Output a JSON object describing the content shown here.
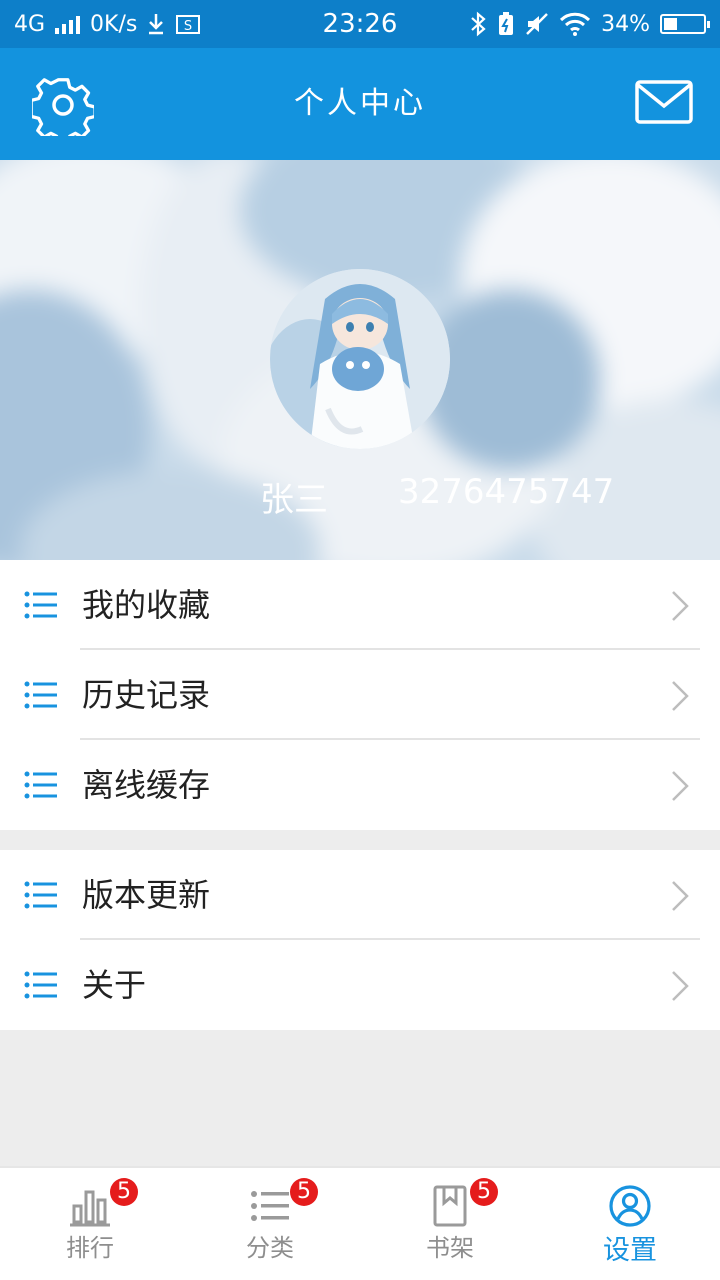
{
  "status_bar": {
    "network": "4G",
    "speed": "0K/s",
    "time": "23:26",
    "battery": "34%"
  },
  "header": {
    "title": "个人中心",
    "left_icon": "gear-icon",
    "right_icon": "mail-icon"
  },
  "profile": {
    "name": "张三",
    "id": "3276475747"
  },
  "menu": {
    "group1": [
      {
        "label": "我的收藏"
      },
      {
        "label": "历史记录"
      },
      {
        "label": "离线缓存"
      }
    ],
    "group2": [
      {
        "label": "版本更新"
      },
      {
        "label": "关于"
      }
    ]
  },
  "bottom_nav": {
    "tabs": [
      {
        "label": "排行",
        "badge": "5",
        "icon": "bar-chart-icon"
      },
      {
        "label": "分类",
        "badge": "5",
        "icon": "list-icon"
      },
      {
        "label": "书架",
        "badge": "5",
        "icon": "bookmark-icon"
      },
      {
        "label": "设置",
        "badge": "",
        "icon": "user-circle-icon"
      }
    ]
  },
  "colors": {
    "status_bar": "#0d7fc9",
    "title_bar": "#1393de",
    "accent": "#1893df",
    "badge": "#e51c1c",
    "background": "#ededed"
  }
}
